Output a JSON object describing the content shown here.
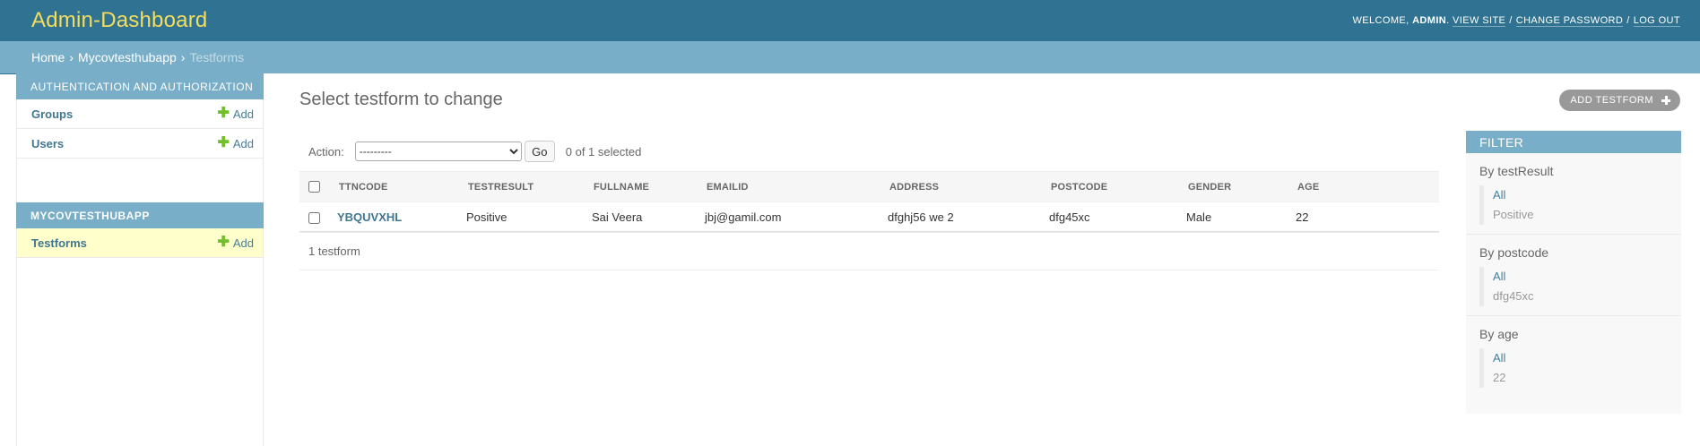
{
  "header": {
    "brand": "Admin-Dashboard",
    "welcome": "Welcome,",
    "username": "admin",
    "view_site": "View site",
    "change_password": "Change password",
    "log_out": "Log out",
    "sep": "/"
  },
  "breadcrumbs": {
    "home": "Home",
    "app": "Mycovtesthubapp",
    "current": "Testforms",
    "sep": "›"
  },
  "sidebar": {
    "apps": [
      {
        "name": "Authentication and Authorization",
        "models": [
          {
            "name": "Groups",
            "add": "Add"
          },
          {
            "name": "Users",
            "add": "Add"
          }
        ]
      },
      {
        "name": "Mycovtesthubapp",
        "models": [
          {
            "name": "Testforms",
            "add": "Add"
          }
        ]
      }
    ]
  },
  "content": {
    "title": "Select testform to change",
    "add_button": "Add testform",
    "action_label": "Action:",
    "action_selected": "---------",
    "go_label": "Go",
    "selection_counter": "0 of 1 selected",
    "paginator": "1 testform"
  },
  "table": {
    "headers": [
      "TTNCODE",
      "TESTRESULT",
      "FULLNAME",
      "EMAILID",
      "ADDRESS",
      "POSTCODE",
      "GENDER",
      "AGE"
    ],
    "rows": [
      [
        "YBQUVXHL",
        "Positive",
        "Sai Veera",
        "jbj@gamil.com",
        "dfghj56 we 2",
        "dfg45xc",
        "Male",
        "22"
      ]
    ]
  },
  "filter": {
    "title": "Filter",
    "groups": [
      {
        "title": "By testResult",
        "options": [
          "All",
          "Positive"
        ]
      },
      {
        "title": "By postcode",
        "options": [
          "All",
          "dfg45xc"
        ]
      },
      {
        "title": "By age",
        "options": [
          "All",
          "22"
        ]
      }
    ]
  },
  "colors": {
    "header_bg": "#2f7291",
    "brand": "#f5dd5d",
    "breadcrumbs_bg": "#79aec8",
    "link": "#417690",
    "current_model_bg": "#ffffcc",
    "add_icon": "#70bf2b"
  },
  "icons": {
    "add": "plus-icon",
    "add_button": "plus-icon"
  }
}
